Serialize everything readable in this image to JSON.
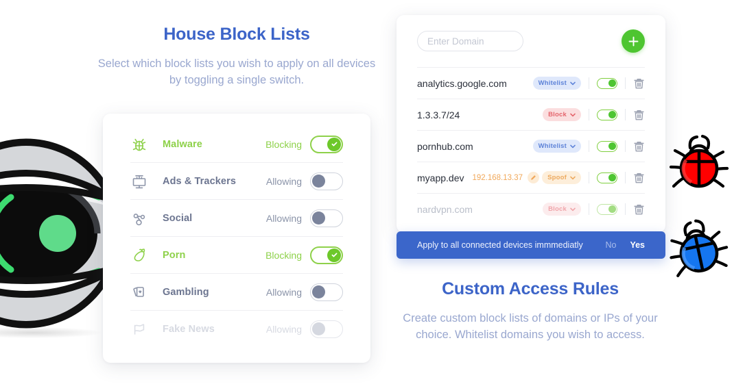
{
  "left": {
    "title": "House Block Lists",
    "subtitle": "Select which block lists you wish to apply on all devices by toggling a single switch.",
    "rows": [
      {
        "icon": "bug-icon",
        "label": "Malware",
        "state": "Blocking",
        "on": true,
        "dim": false
      },
      {
        "icon": "billboard-icon",
        "label": "Ads & Trackers",
        "state": "Allowing",
        "on": false,
        "dim": false
      },
      {
        "icon": "share-nodes-icon",
        "label": "Social",
        "state": "Allowing",
        "on": false,
        "dim": false
      },
      {
        "icon": "eggplant-icon",
        "label": "Porn",
        "state": "Blocking",
        "on": true,
        "dim": false
      },
      {
        "icon": "cards-icon",
        "label": "Gambling",
        "state": "Allowing",
        "on": false,
        "dim": false
      },
      {
        "icon": "flag-icon",
        "label": "Fake News",
        "state": "Allowing",
        "on": false,
        "dim": true
      }
    ]
  },
  "right": {
    "title": "Custom Access Rules",
    "subtitle": "Create custom block lists of domains or IPs of your choice. Whitelist domains you wish to access.",
    "domain_input": {
      "value": "",
      "placeholder": "Enter Domain"
    },
    "add_label": "+",
    "rows": [
      {
        "domain": "analytics.google.com",
        "ip": "",
        "badge": "Whitelist",
        "badge_kind": "whitelist",
        "enabled": true,
        "dim": false
      },
      {
        "domain": "1.3.3.7/24",
        "ip": "",
        "badge": "Block",
        "badge_kind": "block",
        "enabled": true,
        "dim": false
      },
      {
        "domain": "pornhub.com",
        "ip": "",
        "badge": "Whitelist",
        "badge_kind": "whitelist",
        "enabled": true,
        "dim": false
      },
      {
        "domain": "myapp.dev",
        "ip": "192.168.13.37",
        "badge": "Spoof",
        "badge_kind": "spoof",
        "enabled": true,
        "dim": false
      },
      {
        "domain": "nardvpn.com",
        "ip": "",
        "badge": "Block",
        "badge_kind": "block",
        "enabled": true,
        "dim": true
      }
    ],
    "apply_bar": {
      "text": "Apply to all connected devices immmediatly",
      "no": "No",
      "yes": "Yes"
    }
  },
  "decor": {
    "eye": "eye-illustration",
    "bug_red": "red-bug-illustration",
    "bug_blue": "blue-bug-illustration"
  },
  "colors": {
    "brand_blue": "#3c64c8",
    "muted_blue": "#99a7cf",
    "green": "#8ed14a",
    "green_solid": "#4ec531",
    "badge_blue_bg": "#dfe8fb",
    "badge_red_bg": "#fbdedf",
    "badge_orange_bg": "#fdeeda",
    "bar_blue": "#3b66ca"
  }
}
